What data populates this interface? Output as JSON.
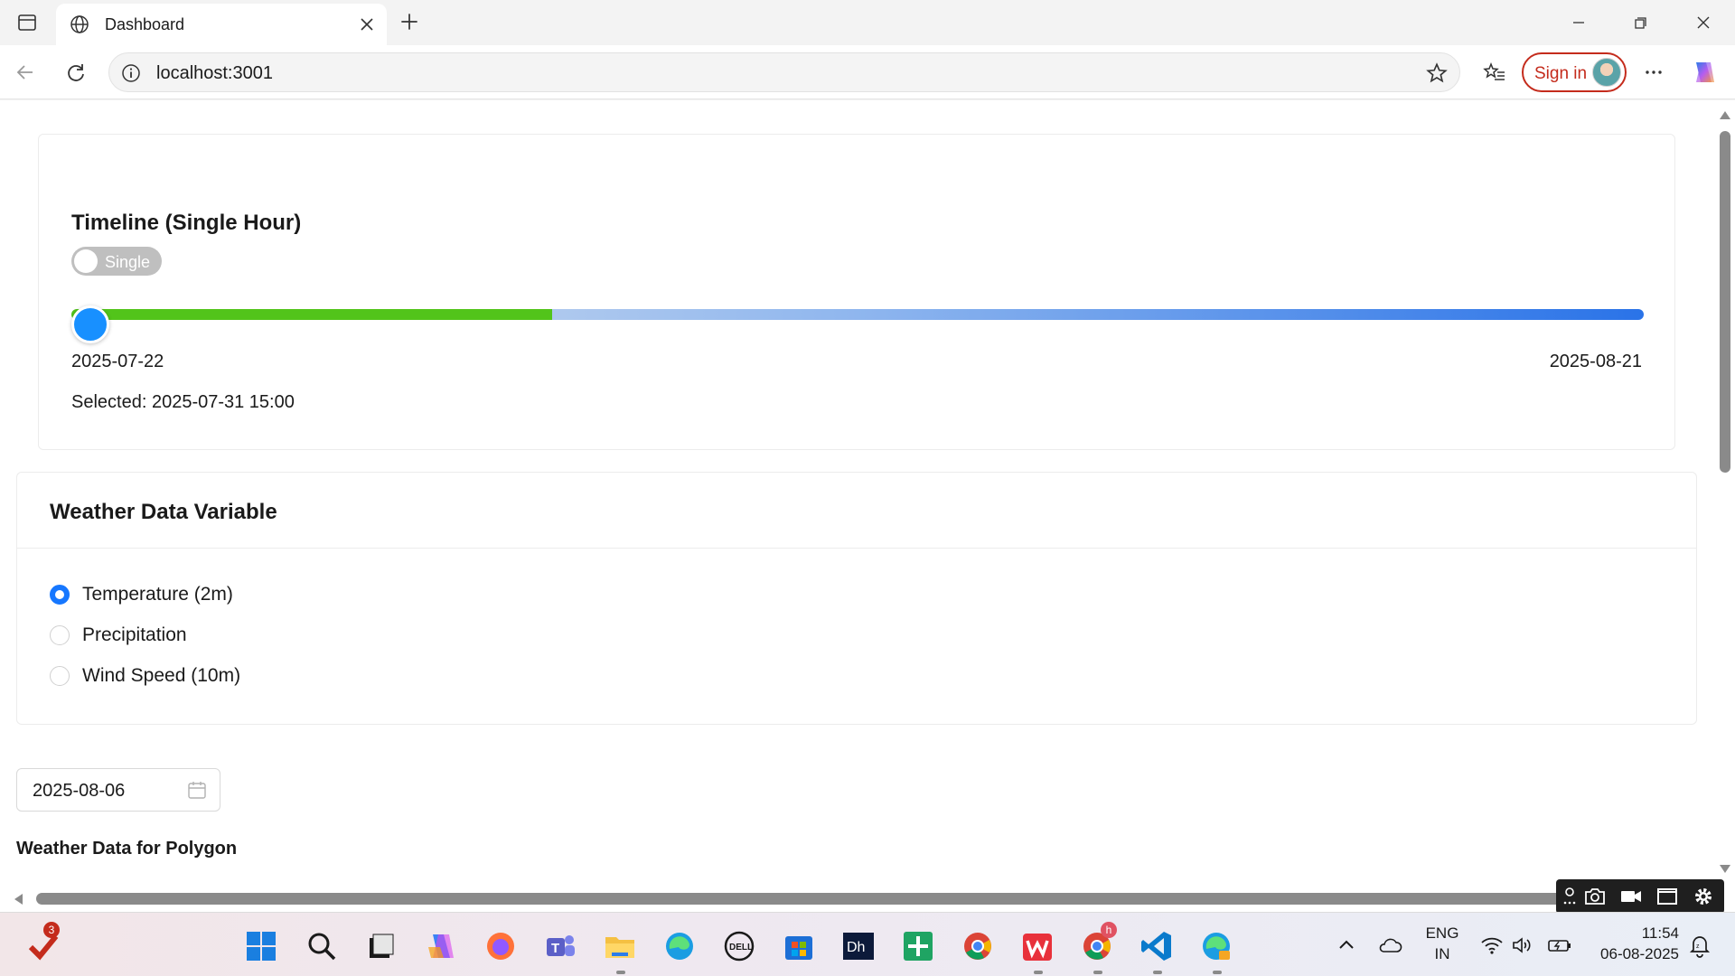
{
  "browser": {
    "tab_title": "Dashboard",
    "url": "localhost:3001",
    "sign_in_label": "Sign in"
  },
  "timeline": {
    "title": "Timeline (Single Hour)",
    "toggle_label": "Single",
    "toggle_on": false,
    "start_date": "2025-07-22",
    "end_date": "2025-08-21",
    "selected": "Selected: 2025-07-31 15:00",
    "fill_fraction": 0.306,
    "handle_fraction": 0.0
  },
  "weather_variable": {
    "title": "Weather Data Variable",
    "options": [
      {
        "label": "Temperature (2m)",
        "selected": true
      },
      {
        "label": "Precipitation",
        "selected": false
      },
      {
        "label": "Wind Speed (10m)",
        "selected": false
      }
    ]
  },
  "date_picker": {
    "value": "2025-08-06"
  },
  "polygon_section": {
    "title": "Weather Data for Polygon"
  },
  "taskbar": {
    "apps": [
      "windows-start",
      "search",
      "task-view",
      "copilot",
      "firefox",
      "teams",
      "file-explorer",
      "edge",
      "dell",
      "microsoft-store",
      "dh-app",
      "sheets-app",
      "chrome",
      "wps-office",
      "chrome-profile",
      "vscode",
      "edge-dev"
    ],
    "notification_badge": "3",
    "chrome_profile_badge": "h",
    "language": "ENG",
    "region": "IN",
    "time": "11:54",
    "date": "06-08-2025"
  },
  "colors": {
    "accent": "#1677ff",
    "slider_fill": "#52c41a",
    "slider_handle": "#1890ff",
    "sign_in": "#c42b1c"
  }
}
